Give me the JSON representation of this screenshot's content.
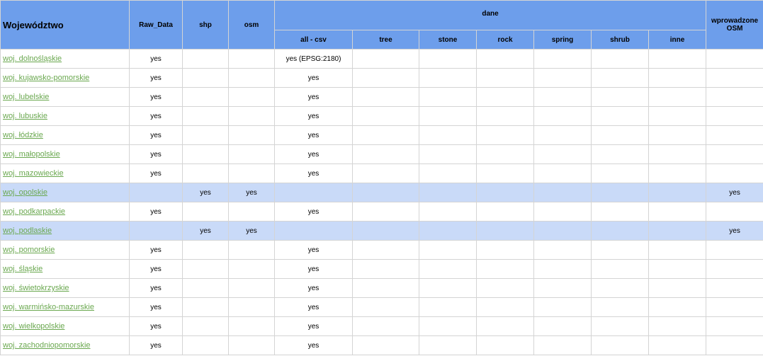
{
  "header": {
    "wojewodztwo": "Województwo",
    "raw_data": "Raw_Data",
    "shp": "shp",
    "osm": "osm",
    "dane": "dane",
    "wprowadzone": "wprowadzone OSM",
    "sub": [
      "all - csv",
      "tree",
      "stone",
      "rock",
      "spring",
      "shrub",
      "inne"
    ]
  },
  "colors": {
    "header_bg": "#6d9eeb",
    "highlight_row_bg": "#c9daf8",
    "link": "#6aa84f",
    "grid": "#d4d4d4"
  },
  "rows": [
    {
      "name": "woj. dolnośląskie",
      "raw": "yes",
      "shp": "",
      "osm": "",
      "csv": "yes (EPSG:2180)",
      "wpr": "",
      "highlight": false
    },
    {
      "name": "woj. kujawsko-pomorskie",
      "raw": "yes",
      "shp": "",
      "osm": "",
      "csv": "yes",
      "wpr": "",
      "highlight": false
    },
    {
      "name": "woj. lubelskie",
      "raw": "yes",
      "shp": "",
      "osm": "",
      "csv": "yes",
      "wpr": "",
      "highlight": false
    },
    {
      "name": "woj. lubuskie",
      "raw": "yes",
      "shp": "",
      "osm": "",
      "csv": "yes",
      "wpr": "",
      "highlight": false
    },
    {
      "name": "woj. łódzkie",
      "raw": "yes",
      "shp": "",
      "osm": "",
      "csv": "yes",
      "wpr": "",
      "highlight": false
    },
    {
      "name": "woj. małopolskie",
      "raw": "yes",
      "shp": "",
      "osm": "",
      "csv": "yes",
      "wpr": "",
      "highlight": false
    },
    {
      "name": "woj. mazowieckie",
      "raw": "yes",
      "shp": "",
      "osm": "",
      "csv": "yes",
      "wpr": "",
      "highlight": false
    },
    {
      "name": "woj. opolskie",
      "raw": "",
      "shp": "yes",
      "osm": "yes",
      "csv": "",
      "wpr": "yes",
      "highlight": true
    },
    {
      "name": "woj. podkarpackie",
      "raw": "yes",
      "shp": "",
      "osm": "",
      "csv": "yes",
      "wpr": "",
      "highlight": false
    },
    {
      "name": "woj. podlaskie",
      "raw": "",
      "shp": "yes",
      "osm": "yes",
      "csv": "",
      "wpr": "yes",
      "highlight": true
    },
    {
      "name": "woj. pomorskie",
      "raw": "yes",
      "shp": "",
      "osm": "",
      "csv": "yes",
      "wpr": "",
      "highlight": false
    },
    {
      "name": "woj. śląskie",
      "raw": "yes",
      "shp": "",
      "osm": "",
      "csv": "yes",
      "wpr": "",
      "highlight": false
    },
    {
      "name": "woj. świetokrzyskie",
      "raw": "yes",
      "shp": "",
      "osm": "",
      "csv": "yes",
      "wpr": "",
      "highlight": false
    },
    {
      "name": "woj. warmińsko-mazurskie",
      "raw": "yes",
      "shp": "",
      "osm": "",
      "csv": "yes",
      "wpr": "",
      "highlight": false
    },
    {
      "name": "woj. wielkopolskie",
      "raw": "yes",
      "shp": "",
      "osm": "",
      "csv": "yes",
      "wpr": "",
      "highlight": false
    },
    {
      "name": "woj. zachodniopomorskie",
      "raw": "yes",
      "shp": "",
      "osm": "",
      "csv": "yes",
      "wpr": "",
      "highlight": false
    }
  ]
}
